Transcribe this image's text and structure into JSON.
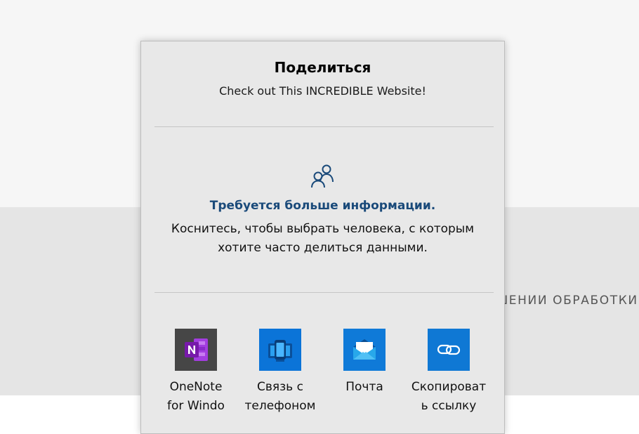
{
  "background": {
    "fragment_text": "ШЕНИИ ОБРАБОТКИ"
  },
  "share": {
    "title": "Поделиться",
    "subtitle": "Check out This INCREDIBLE Website!",
    "contacts": {
      "icon": "people-icon",
      "title": "Требуется больше информации.",
      "description": "Коснитесь, чтобы выбрать человека, с которым хотите часто делиться данными."
    },
    "apps": [
      {
        "label": "OneNote\nfor Windo",
        "icon": "onenote-icon",
        "color": "#464646"
      },
      {
        "label": "Связь с\nтелефоном",
        "icon": "your-phone-icon",
        "color": "#0b74d8"
      },
      {
        "label": "Почта",
        "icon": "mail-icon",
        "color": "#0f7ad8"
      },
      {
        "label": "Скопироват\nь ссылку",
        "icon": "copy-link-icon",
        "color": "#0f78d4"
      }
    ]
  },
  "colors": {
    "accent_text": "#1a4a7a",
    "panel_bg": "#e8e8e8"
  }
}
